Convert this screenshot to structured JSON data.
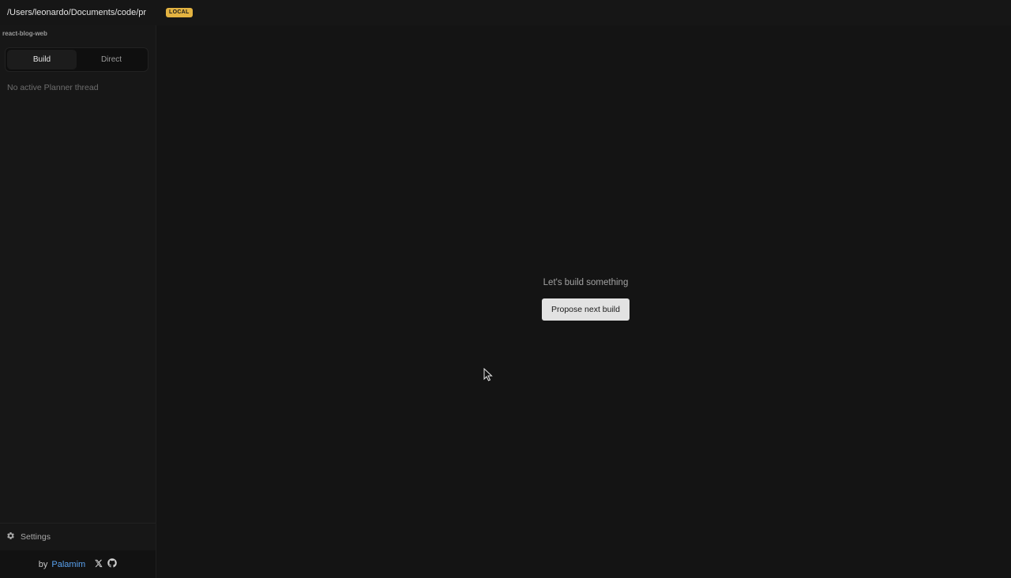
{
  "topbar": {
    "path": "/Users/leonardo/Documents/code/project",
    "badge": "LOCAL"
  },
  "sidebar": {
    "project_name": "react-blog-web",
    "modes": [
      {
        "label": "Build",
        "active": true
      },
      {
        "label": "Direct",
        "active": false
      }
    ],
    "empty_state": "No active Planner thread",
    "settings_label": "Settings"
  },
  "footer": {
    "by": "by",
    "author": "Palamim"
  },
  "main": {
    "heading": "Let's build something",
    "action_label": "Propose next build"
  },
  "colors": {
    "badge": "#e3b341",
    "link": "#5aa2f0"
  }
}
